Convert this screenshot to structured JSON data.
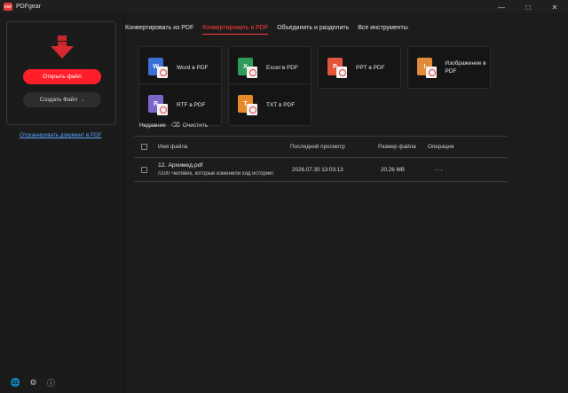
{
  "app": {
    "title": "PDFgear",
    "logo_text": "PDF"
  },
  "sidebar": {
    "open_label": "Открыть файл",
    "create_label": "Создать Файл",
    "scan_label": "Отсканировать документ в PDF",
    "bottom_icons": [
      "globe-icon",
      "tools-icon",
      "info-icon"
    ]
  },
  "tabs": [
    {
      "label": "Конвертировать из PDF",
      "active": false
    },
    {
      "label": "Конвертировать в PDF",
      "active": true
    },
    {
      "label": "Объединить и разделить",
      "active": false
    },
    {
      "label": "Все инструменты",
      "active": false
    }
  ],
  "tiles": [
    {
      "label": "Word в PDF",
      "icon_letter": "W",
      "color": "#3b6fd6"
    },
    {
      "label": "Excel в PDF",
      "icon_letter": "X",
      "color": "#2f9a5a"
    },
    {
      "label": "PPT в PDF",
      "icon_letter": "P",
      "color": "#e2553b"
    },
    {
      "label": "Изображение в PDF",
      "icon_letter": "I",
      "color": "#e28b3b"
    },
    {
      "label": "RTF в PDF",
      "icon_letter": "R",
      "color": "#7b65c9"
    },
    {
      "label": "TXT в PDF",
      "icon_letter": "T",
      "color": "#e88a2a"
    }
  ],
  "recent": {
    "label": "Недавние",
    "clear_label": "Очистить"
  },
  "table": {
    "headers": {
      "name": "Имя файла",
      "last_viewed": "Последний просмотр",
      "size": "Размер файла",
      "operation": "Операция"
    },
    "rows": [
      {
        "name": "12. Архимед.pdf",
        "title": "/\\100 Человек, которые изменили ход истории\\",
        "last_viewed": "2026.07.30 13:03:13",
        "size": "20,26 MB",
        "operation": "···"
      }
    ]
  },
  "colors": {
    "accent": "#ff1f2b",
    "link": "#5aa5ff",
    "background": "#1c1c1c"
  }
}
